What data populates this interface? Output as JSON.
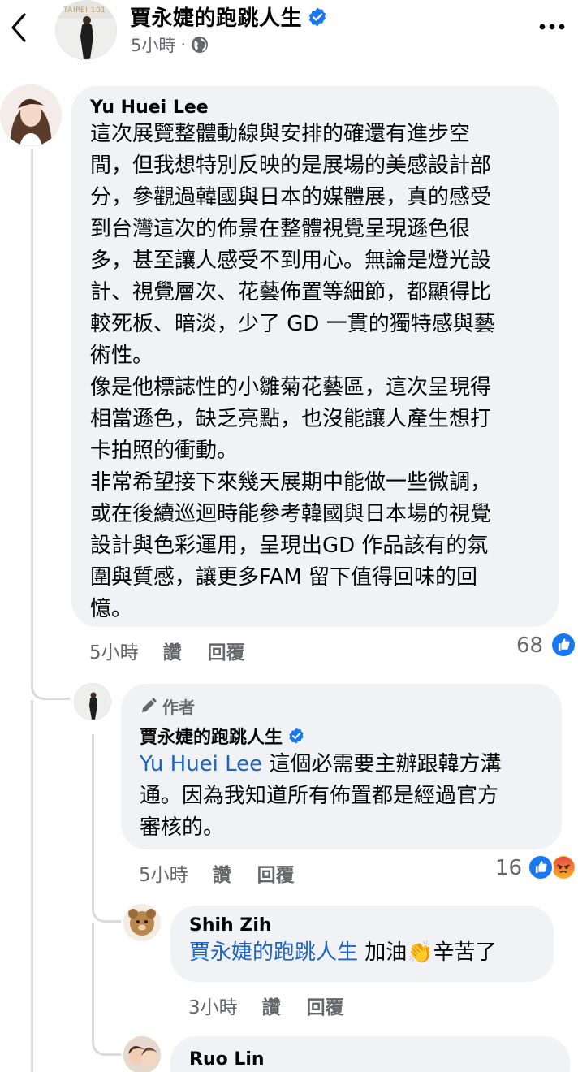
{
  "header": {
    "page_name": "賈永婕的跑跳人生",
    "time": "5小時",
    "dot": "·",
    "avatar_text": "TAIPEI 101"
  },
  "colors": {
    "accent": "#1877f2",
    "mention": "#1b63c7",
    "bubble": "#f0f2f5",
    "muted": "#65676b"
  },
  "comments": [
    {
      "author": "Yu Huei Lee",
      "lines": [
        "這次展覽整體動線與安排的確還有進步空",
        "間，但我想特別反映的是展場的美感設計部",
        "分，參觀過韓國與日本的媒體展，真的感受",
        "到台灣這次的佈景在整體視覺呈現遜色很",
        "多，甚至讓人感受不到用心。無論是燈光設",
        "計、視覺層次、花藝佈置等細節，都顯得比",
        "較死板、暗淡，少了 GD 一貫的獨特感與藝",
        "術性。",
        "像是他標誌性的小雛菊花藝區，這次呈現得",
        "相當遜色，缺乏亮點，也沒能讓人產生想打",
        "卡拍照的衝動。",
        "非常希望接下來幾天展期中能做一些微調，",
        "或在後續巡迴時能參考韓國與日本場的視覺",
        "設計與色彩運用，呈現出GD 作品該有的氛",
        "圍與質感，讓更多FAM 留下值得回味的回",
        "憶。"
      ],
      "time": "5小時",
      "like": "讚",
      "reply": "回覆",
      "reactions": "68"
    },
    {
      "badge": "作者",
      "author": "賈永婕的跑跳人生",
      "mention": "Yu Huei Lee",
      "line1_rest": " 這個必需要主辦跟韓方溝",
      "line2": "通。因為我知道所有佈置都是經過官方",
      "line3": "審核的。",
      "time": "5小時",
      "like": "讚",
      "reply": "回覆",
      "reactions": "16"
    },
    {
      "author": "Shih Zih",
      "mention": "賈永婕的跑跳人生",
      "text_before": " 加油",
      "emoji": "👏",
      "text_after": "辛苦了",
      "time": "3小時",
      "like": "讚",
      "reply": "回覆"
    },
    {
      "author": "Ruo Lin"
    }
  ]
}
